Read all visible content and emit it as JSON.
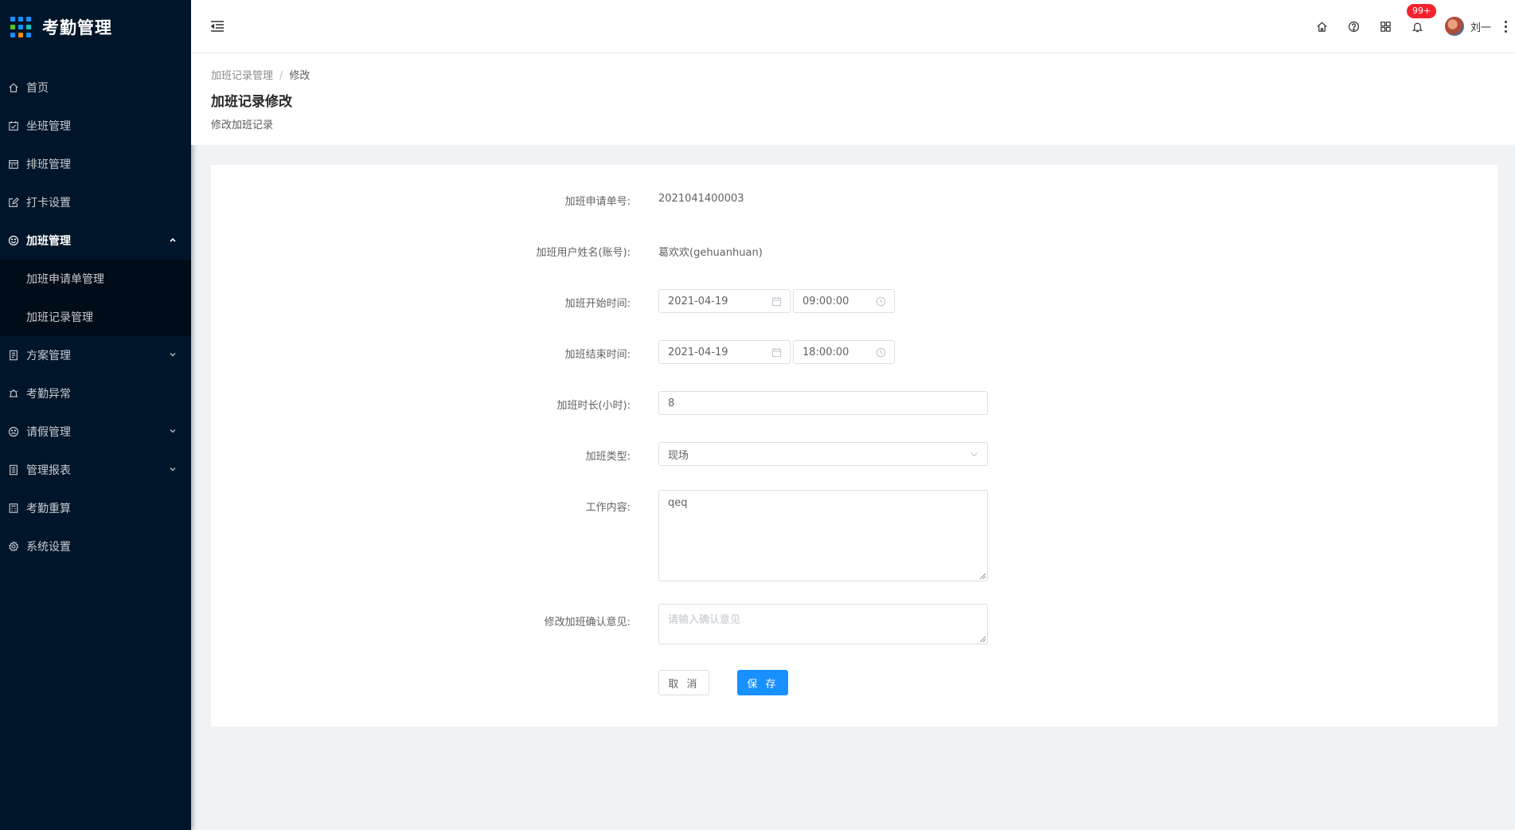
{
  "app": {
    "title": "考勤管理"
  },
  "sidebar": {
    "items": [
      {
        "label": "首页",
        "icon": "home-icon"
      },
      {
        "label": "坐班管理",
        "icon": "calendar-check-icon"
      },
      {
        "label": "排班管理",
        "icon": "schedule-icon"
      },
      {
        "label": "打卡设置",
        "icon": "edit-icon"
      },
      {
        "label": "加班管理",
        "icon": "smile-icon",
        "expanded": true,
        "children": [
          {
            "label": "加班申请单管理"
          },
          {
            "label": "加班记录管理"
          }
        ]
      },
      {
        "label": "方案管理",
        "icon": "file-icon"
      },
      {
        "label": "考勤异常",
        "icon": "alarm-icon"
      },
      {
        "label": "请假管理",
        "icon": "frown-icon"
      },
      {
        "label": "管理报表",
        "icon": "report-icon"
      },
      {
        "label": "考勤重算",
        "icon": "calculator-icon"
      },
      {
        "label": "系统设置",
        "icon": "setting-icon"
      }
    ]
  },
  "header": {
    "badge": "99+",
    "username": "刘一"
  },
  "breadcrumb": {
    "parent": "加班记录管理",
    "separator": "/",
    "current": "修改"
  },
  "page": {
    "title": "加班记录修改",
    "subtitle": "修改加班记录"
  },
  "form": {
    "apply_no": {
      "label": "加班申请单号:",
      "value": "2021041400003"
    },
    "user": {
      "label": "加班用户姓名(账号):",
      "value": "葛欢欢(gehuanhuan)"
    },
    "start": {
      "label": "加班开始时间:",
      "date": "2021-04-19",
      "time": "09:00:00"
    },
    "end": {
      "label": "加班结束时间:",
      "date": "2021-04-19",
      "time": "18:00:00"
    },
    "duration": {
      "label": "加班时长(小时):",
      "value": "8"
    },
    "type": {
      "label": "加班类型:",
      "value": "现场"
    },
    "content": {
      "label": "工作内容:",
      "value": "qeq"
    },
    "opinion": {
      "label": "修改加班确认意见:",
      "placeholder": "请输入确认意见"
    },
    "cancel_label": "取 消",
    "save_label": "保 存"
  },
  "colors": {
    "sidebar_bg": "#001529",
    "primary": "#1890ff",
    "badge": "#f5222d"
  }
}
